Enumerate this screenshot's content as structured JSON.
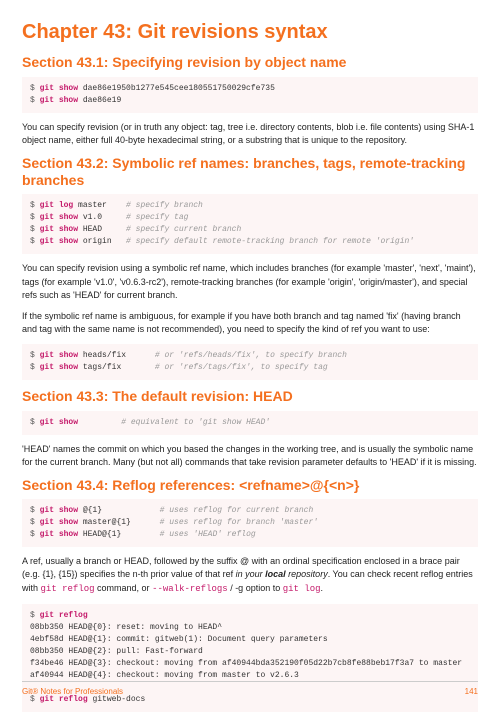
{
  "chapter": {
    "title": "Chapter 43: Git revisions syntax"
  },
  "s1": {
    "title": "Section 43.1: Specifying revision by object name",
    "code": "$ <git show> dae86e1950b1277e545cee180551750029cfe735\n$ <git show> dae86e19",
    "p1": "You can specify revision (or in truth any object: tag, tree i.e. directory contents, blob i.e. file contents) using SHA-1 object name, either full 40-byte hexadecimal string, or a substring that is unique to the repository."
  },
  "s2": {
    "title": "Section 43.2: Symbolic ref names: branches, tags, remote-tracking branches",
    "code1": "$ <git log> master    |# specify branch|\n$ <git show> v1.0     |# specify tag|\n$ <git show> HEAD     |# specify current branch|\n$ <git show> origin   |# specify default remote-tracking branch for remote 'origin'|",
    "p1": "You can specify revision using a symbolic ref name, which includes branches (for example 'master', 'next', 'maint'), tags (for example 'v1.0', 'v0.6.3-rc2'), remote-tracking branches (for example 'origin', 'origin/master'), and special refs such as 'HEAD' for current branch.",
    "p2": "If the symbolic ref name is ambiguous, for example if you have both branch and tag named 'fix' (having branch and tag with the same name is not recommended), you need to specify the kind of ref you want to use:",
    "code2": "$ <git show> heads/fix      |# or 'refs/heads/fix', to specify branch|\n$ <git show> tags/fix       |# or 'refs/tags/fix', to specify tag|"
  },
  "s3": {
    "title": "Section 43.3: The default revision: HEAD",
    "code": "$ <git show>         |# equivalent to 'git show HEAD'|",
    "p1": "'HEAD' names the commit on which you based the changes in the working tree, and is usually the symbolic name for the current branch. Many (but not all) commands that take revision parameter defaults to 'HEAD' if it is missing."
  },
  "s4": {
    "title": "Section 43.4: Reflog references: <refname>@{<n>}",
    "code1": "$ <git show> @{1}            |# uses reflog for current branch|\n$ <git show> master@{1}      |# uses reflog for branch 'master'|\n$ <git show> HEAD@{1}        |# uses 'HEAD' reflog|",
    "p1_a": "A ref, usually a branch or HEAD, followed by the suffix @ with an ordinal specification enclosed in a brace pair (e.g. {1}, {15}) specifies the n-th prior value of that ref ",
    "p1_b": "in your ",
    "p1_c": "local",
    "p1_d": " repository",
    "p1_e": ". You can check recent reflog entries with ",
    "p1_f": "git reflog",
    "p1_g": " command, or ",
    "p1_h": "--walk-reflogs",
    "p1_i": " / -g option to ",
    "p1_j": "git log",
    "p1_k": ".",
    "code2": "$ <git reflog>\n08bb350 HEAD@{0}: reset: moving to HEAD^\n4ebf58d HEAD@{1}: commit: gitweb(1): Document query parameters\n08bb350 HEAD@{2}: pull: Fast-forward\nf34be46 HEAD@{3}: checkout: moving from af40944bda352190f05d22b7cb8fe88beb17f3a7 to master\naf40944 HEAD@{4}: checkout: moving from master to v2.6.3\n\n$ <git reflog> gitweb-docs"
  },
  "footer": {
    "left": "Git® Notes for Professionals",
    "right": "141"
  }
}
